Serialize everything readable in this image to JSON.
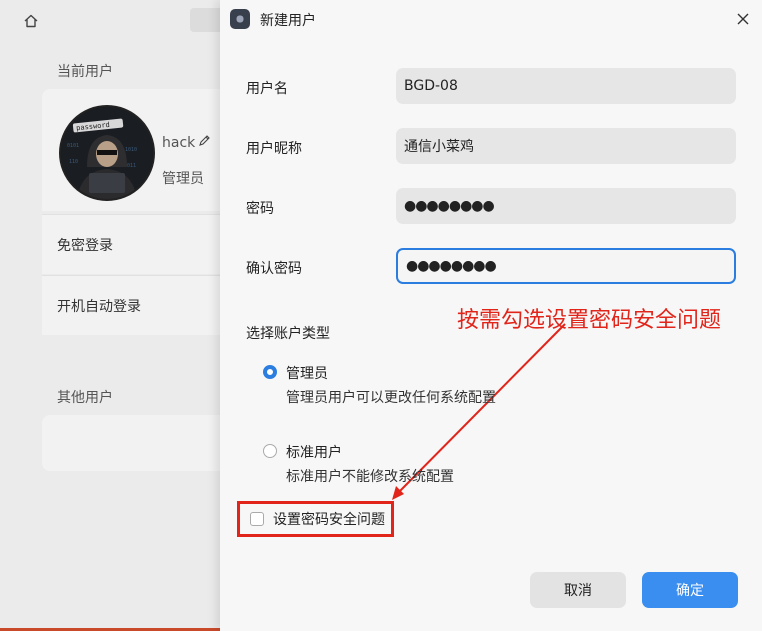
{
  "background": {
    "current_user_title": "当前用户",
    "current_user": {
      "name": "hack",
      "role": "管理员"
    },
    "options": [
      "免密登录",
      "开机自动登录"
    ],
    "other_users_title": "其他用户"
  },
  "dialog": {
    "title": "新建用户",
    "fields": {
      "username": {
        "label": "用户名",
        "value": "BGD-08"
      },
      "nickname": {
        "label": "用户昵称",
        "value": "通信小菜鸡"
      },
      "password": {
        "label": "密码",
        "value": "●●●●●●●●"
      },
      "confirm": {
        "label": "确认密码",
        "value": "●●●●●●●●"
      }
    },
    "account_type_label": "选择账户类型",
    "account_types": [
      {
        "title": "管理员",
        "desc": "管理员用户可以更改任何系统配置",
        "checked": true
      },
      {
        "title": "标准用户",
        "desc": "标准用户不能修改系统配置",
        "checked": false
      }
    ],
    "security_question_label": "设置密码安全问题",
    "security_question_checked": false,
    "cancel_label": "取消",
    "confirm_label": "确定"
  },
  "annotation": {
    "text": "按需勾选设置密码安全问题",
    "color": "#e1251b"
  },
  "colors": {
    "accent": "#2b7de0",
    "button_primary": "#3a8ef0"
  }
}
